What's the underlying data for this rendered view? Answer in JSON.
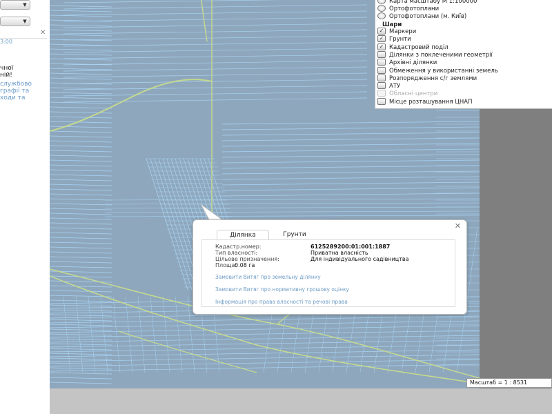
{
  "sidebar": {
    "time_text": "3:00",
    "text_lines": [
      {
        "text": "чної",
        "color": "#222222"
      },
      {
        "text": "ній!",
        "color": "#222222"
      },
      {
        "text": "службово",
        "color": "#6a9ac8"
      },
      {
        "text": "графії та",
        "color": "#6a9ac8"
      },
      {
        "text": "ходи     та",
        "color": "#6a9ac8"
      }
    ],
    "close_icon": "close-icon"
  },
  "layers": {
    "base_maps": [
      {
        "label": "Карта масштабу М 1:100000",
        "control": "radio"
      },
      {
        "label": "Ортофотоплани",
        "control": "radio"
      },
      {
        "label": "Ортофотоплани (м. Київ)",
        "control": "radio"
      }
    ],
    "heading": "Шари",
    "overlays": [
      {
        "label": "Маркери",
        "checked": true,
        "enabled": true
      },
      {
        "label": "Грунти",
        "checked": true,
        "enabled": true
      },
      {
        "label": "Кадастровий поділ",
        "checked": true,
        "enabled": true
      },
      {
        "label": "Ділянки з поклеченими геометрії",
        "checked": false,
        "enabled": true
      },
      {
        "label": "Архівні ділянки",
        "checked": false,
        "enabled": true
      },
      {
        "label": "Обмеження у використанні земель",
        "checked": false,
        "enabled": true
      },
      {
        "label": "Розпорядження с/г землями",
        "checked": false,
        "enabled": true
      },
      {
        "label": "АТУ",
        "checked": false,
        "enabled": true
      },
      {
        "label": "Обласні центри",
        "checked": false,
        "enabled": false
      },
      {
        "label": "Місце розташування ЦНАП",
        "checked": false,
        "enabled": true
      }
    ]
  },
  "popup": {
    "tabs": [
      {
        "label": "Ділянка",
        "active": true
      },
      {
        "label": "Грунти",
        "active": false
      }
    ],
    "close_icon": "close-icon",
    "fields": [
      {
        "label": "Кадастр.номер:",
        "value": "6125289200:01:001:1887"
      },
      {
        "label": "Тип власності:",
        "value": "Приватна власність"
      },
      {
        "label": "Цільове призначення:",
        "value": "Для індивідуального садівництва"
      },
      {
        "label": "Площа:",
        "value": "0.08 га"
      }
    ],
    "links": [
      "Замовити Витяг про земельну ділянку",
      "Замовити Витяг про нормативну грошову оцінку",
      "Інформація про права власності та речові права"
    ]
  },
  "scale": {
    "text": "Масштаб = 1 : 8531"
  },
  "colors": {
    "map_fill": "#8ea7bd",
    "parcel_lines": "#a9d4f4",
    "boundary_lines": "#c4d98f",
    "outside_map": "#7f7f7f",
    "link_color": "#6f9cc6"
  }
}
